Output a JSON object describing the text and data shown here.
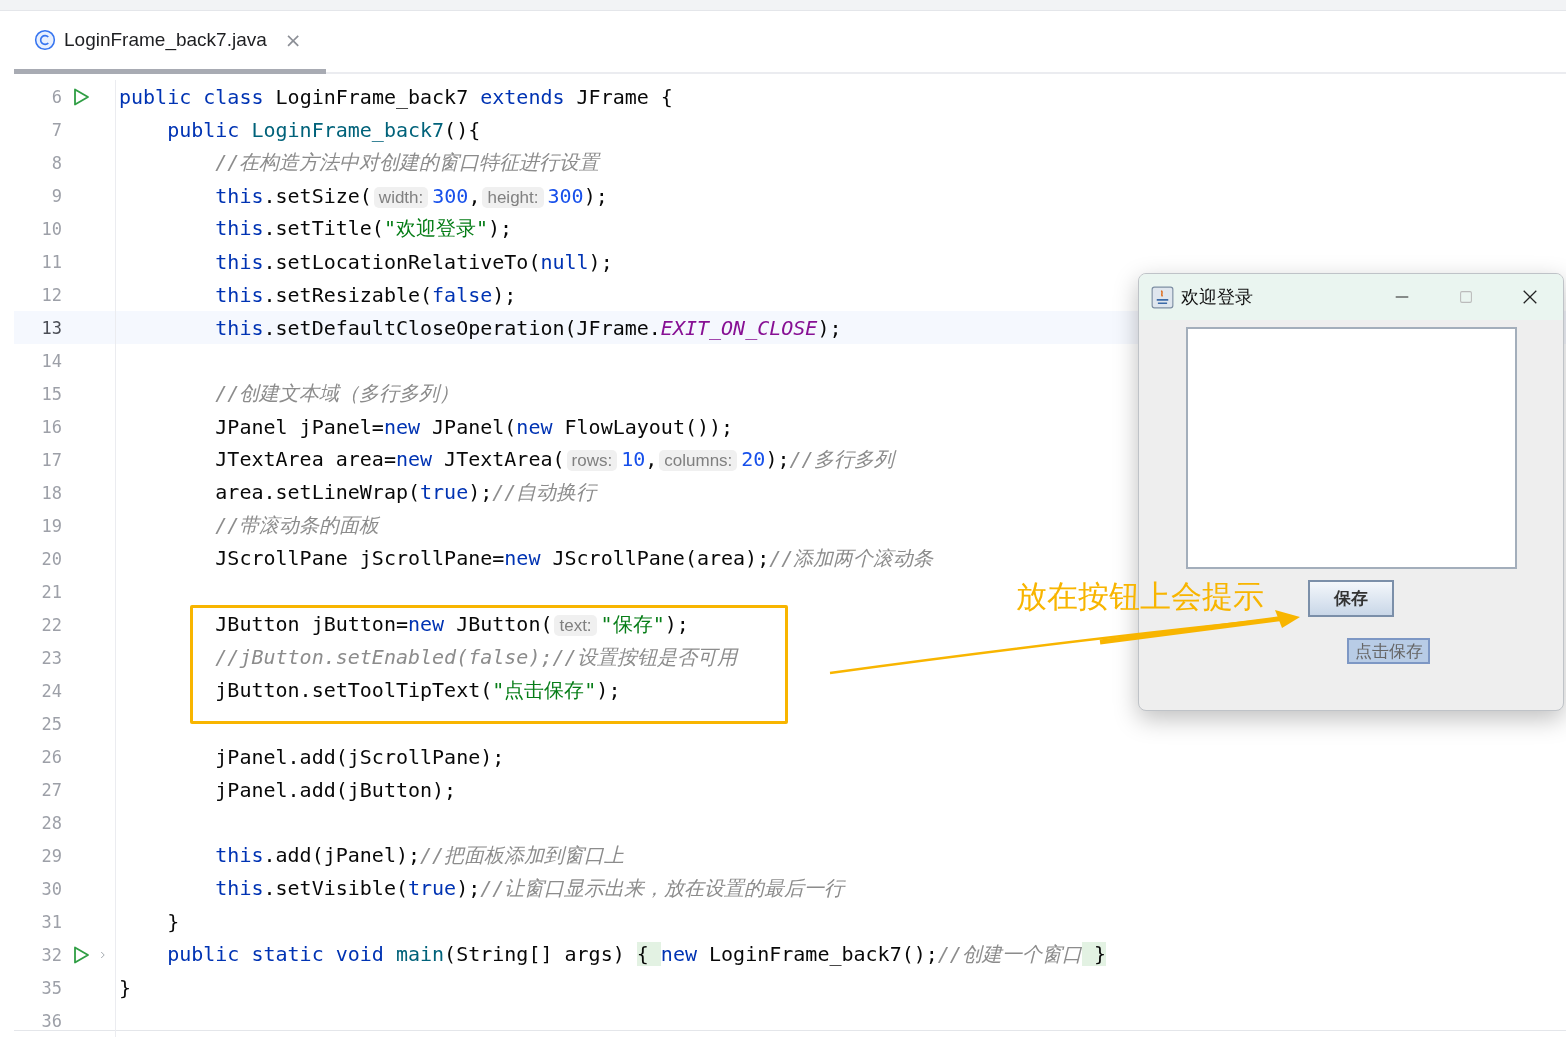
{
  "tab": {
    "title": "LoginFrame_back7.java",
    "close": "×",
    "selected": true
  },
  "editor": {
    "lines": [
      {
        "number": "6",
        "run": true,
        "fold": false,
        "current": false,
        "tokens": [
          {
            "kind": "kw",
            "text": "public class "
          },
          {
            "kind": "plain",
            "text": "LoginFrame_back7 "
          },
          {
            "kind": "kw",
            "text": "extends "
          },
          {
            "kind": "plain",
            "text": "JFrame {"
          }
        ],
        "children": [
          {
            "number": "7",
            "run": false,
            "fold": false,
            "current": false,
            "tokens": [
              {
                "kind": "kw",
                "text": "public "
              },
              {
                "kind": "fn",
                "text": "LoginFrame_back7"
              },
              {
                "kind": "plain",
                "text": "(){"
              }
            ],
            "children": [
              {
                "number": "8",
                "run": false,
                "fold": false,
                "current": false,
                "tokens": [
                  {
                    "kind": "cmt",
                    "text": "//在构造方法中对创建的窗口特征进行设置"
                  }
                ]
              },
              {
                "number": "9",
                "run": false,
                "fold": false,
                "current": false,
                "tokens": [
                  {
                    "kind": "kw",
                    "text": "this"
                  },
                  {
                    "kind": "plain",
                    "text": ".setSize("
                  },
                  {
                    "kind": "hint",
                    "text": "width:"
                  },
                  {
                    "kind": "num",
                    "text": "300"
                  },
                  {
                    "kind": "plain",
                    "text": ","
                  },
                  {
                    "kind": "hint",
                    "text": "height:"
                  },
                  {
                    "kind": "num",
                    "text": "300"
                  },
                  {
                    "kind": "plain",
                    "text": ");"
                  }
                ]
              },
              {
                "number": "10",
                "run": false,
                "fold": false,
                "current": false,
                "tokens": [
                  {
                    "kind": "kw",
                    "text": "this"
                  },
                  {
                    "kind": "plain",
                    "text": ".setTitle("
                  },
                  {
                    "kind": "str",
                    "text": "\"欢迎登录\""
                  },
                  {
                    "kind": "plain",
                    "text": ");"
                  }
                ]
              },
              {
                "number": "11",
                "run": false,
                "fold": false,
                "current": false,
                "tokens": [
                  {
                    "kind": "kw",
                    "text": "this"
                  },
                  {
                    "kind": "plain",
                    "text": ".setLocationRelativeTo("
                  },
                  {
                    "kind": "kw",
                    "text": "null"
                  },
                  {
                    "kind": "plain",
                    "text": ");"
                  }
                ]
              },
              {
                "number": "12",
                "run": false,
                "fold": false,
                "current": false,
                "tokens": [
                  {
                    "kind": "kw",
                    "text": "this"
                  },
                  {
                    "kind": "plain",
                    "text": ".setResizable("
                  },
                  {
                    "kind": "kw",
                    "text": "false"
                  },
                  {
                    "kind": "plain",
                    "text": ");"
                  }
                ]
              },
              {
                "number": "13",
                "run": false,
                "fold": false,
                "current": true,
                "tokens": [
                  {
                    "kind": "kw",
                    "text": "this"
                  },
                  {
                    "kind": "plain",
                    "text": ".setDefaultCloseOperation(JFrame."
                  },
                  {
                    "kind": "const",
                    "text": "EXIT_ON_CLOSE"
                  },
                  {
                    "kind": "plain",
                    "text": ");"
                  }
                ]
              },
              {
                "number": "14",
                "run": false,
                "fold": false,
                "current": false
              },
              {
                "number": "15",
                "run": false,
                "fold": false,
                "current": false,
                "tokens": [
                  {
                    "kind": "cmt",
                    "text": "//创建文本域（多行多列）"
                  }
                ]
              },
              {
                "number": "16",
                "run": false,
                "fold": false,
                "current": false,
                "tokens": [
                  {
                    "kind": "plain",
                    "text": "JPanel jPanel="
                  },
                  {
                    "kind": "kw",
                    "text": "new"
                  },
                  {
                    "kind": "plain",
                    "text": " JPanel("
                  },
                  {
                    "kind": "kw",
                    "text": "new"
                  },
                  {
                    "kind": "plain",
                    "text": " FlowLayout());"
                  }
                ]
              },
              {
                "number": "17",
                "run": false,
                "fold": false,
                "current": false,
                "tokens": [
                  {
                    "kind": "plain",
                    "text": "JTextArea area="
                  },
                  {
                    "kind": "kw",
                    "text": "new"
                  },
                  {
                    "kind": "plain",
                    "text": " JTextArea("
                  },
                  {
                    "kind": "hint",
                    "text": "rows:"
                  },
                  {
                    "kind": "num",
                    "text": "10"
                  },
                  {
                    "kind": "plain",
                    "text": ","
                  },
                  {
                    "kind": "hint",
                    "text": "columns:"
                  },
                  {
                    "kind": "num",
                    "text": "20"
                  },
                  {
                    "kind": "plain",
                    "text": ");"
                  },
                  {
                    "kind": "cmt",
                    "text": "//多行多列"
                  }
                ]
              },
              {
                "number": "18",
                "run": false,
                "fold": false,
                "current": false,
                "tokens": [
                  {
                    "kind": "plain",
                    "text": "area.setLineWrap("
                  },
                  {
                    "kind": "kw",
                    "text": "true"
                  },
                  {
                    "kind": "plain",
                    "text": ");"
                  },
                  {
                    "kind": "cmt",
                    "text": "//自动换行"
                  }
                ]
              },
              {
                "number": "19",
                "run": false,
                "fold": false,
                "current": false,
                "tokens": [
                  {
                    "kind": "cmt",
                    "text": "//带滚动条的面板"
                  }
                ]
              },
              {
                "number": "20",
                "run": false,
                "fold": false,
                "current": false,
                "tokens": [
                  {
                    "kind": "plain",
                    "text": "JScrollPane jScrollPane="
                  },
                  {
                    "kind": "kw",
                    "text": "new"
                  },
                  {
                    "kind": "plain",
                    "text": " JScrollPane(area);"
                  },
                  {
                    "kind": "cmt",
                    "text": "//添加两个滚动条"
                  }
                ]
              },
              {
                "number": "21",
                "run": false,
                "fold": false,
                "current": false
              },
              {
                "number": "22",
                "run": false,
                "fold": false,
                "current": false,
                "tokens": [
                  {
                    "kind": "plain",
                    "text": "JButton jButton="
                  },
                  {
                    "kind": "kw",
                    "text": "new"
                  },
                  {
                    "kind": "plain",
                    "text": " JButton("
                  },
                  {
                    "kind": "hint",
                    "text": "text:"
                  },
                  {
                    "kind": "str",
                    "text": "\"保存\""
                  },
                  {
                    "kind": "plain",
                    "text": ");"
                  }
                ]
              },
              {
                "number": "23",
                "run": false,
                "fold": false,
                "current": false,
                "tokens": [
                  {
                    "kind": "cmt",
                    "text": "//jButton.setEnabled(false);//设置按钮是否可用"
                  }
                ]
              },
              {
                "number": "24",
                "run": false,
                "fold": false,
                "current": false,
                "tokens": [
                  {
                    "kind": "plain",
                    "text": "jButton.setToolTipText("
                  },
                  {
                    "kind": "str",
                    "text": "\"点击保存\""
                  },
                  {
                    "kind": "plain",
                    "text": ");"
                  }
                ]
              },
              {
                "number": "25",
                "run": false,
                "fold": false,
                "current": false
              },
              {
                "number": "26",
                "run": false,
                "fold": false,
                "current": false,
                "tokens": [
                  {
                    "kind": "plain",
                    "text": "jPanel.add(jScrollPane);"
                  }
                ]
              },
              {
                "number": "27",
                "run": false,
                "fold": false,
                "current": false,
                "tokens": [
                  {
                    "kind": "plain",
                    "text": "jPanel.add(jButton);"
                  }
                ]
              },
              {
                "number": "28",
                "run": false,
                "fold": false,
                "current": false
              },
              {
                "number": "29",
                "run": false,
                "fold": false,
                "current": false,
                "tokens": [
                  {
                    "kind": "kw",
                    "text": "this"
                  },
                  {
                    "kind": "plain",
                    "text": ".add(jPanel);"
                  },
                  {
                    "kind": "cmt",
                    "text": "//把面板添加到窗口上"
                  }
                ]
              },
              {
                "number": "30",
                "run": false,
                "fold": false,
                "current": false,
                "tokens": [
                  {
                    "kind": "kw",
                    "text": "this"
                  },
                  {
                    "kind": "plain",
                    "text": ".setVisible("
                  },
                  {
                    "kind": "kw",
                    "text": "true"
                  },
                  {
                    "kind": "plain",
                    "text": ");"
                  },
                  {
                    "kind": "cmt",
                    "text": "//让窗口显示出来，放在设置的最后一行"
                  }
                ]
              }
            ]
          },
          {
            "number": "31",
            "run": false,
            "fold": false,
            "current": false,
            "tokens": [
              {
                "kind": "plain",
                "text": "}"
              }
            ]
          },
          {
            "number": "32",
            "run": true,
            "fold": true,
            "current": false,
            "tokens": [
              {
                "kind": "kw",
                "text": "public static void "
              },
              {
                "kind": "fn",
                "text": "main"
              },
              {
                "kind": "plain",
                "text": "(String[] args) "
              },
              {
                "kind": "brace",
                "text": "{ "
              },
              {
                "kind": "kw",
                "text": "new"
              },
              {
                "kind": "plain",
                "text": " LoginFrame_back7();"
              },
              {
                "kind": "cmt",
                "text": "//创建一个窗口"
              },
              {
                "kind": "brace",
                "text": " }"
              }
            ]
          }
        ]
      },
      {
        "number": "35",
        "run": false,
        "fold": false,
        "current": false,
        "tokens": [
          {
            "kind": "plain",
            "text": "}"
          }
        ]
      },
      {
        "number": "36",
        "run": false,
        "fold": false,
        "current": false
      }
    ]
  },
  "dialog": {
    "title": "欢迎登录",
    "button": "保存",
    "tooltip": "点击保存"
  },
  "annotation": {
    "text": "放在按钮上会提示"
  }
}
